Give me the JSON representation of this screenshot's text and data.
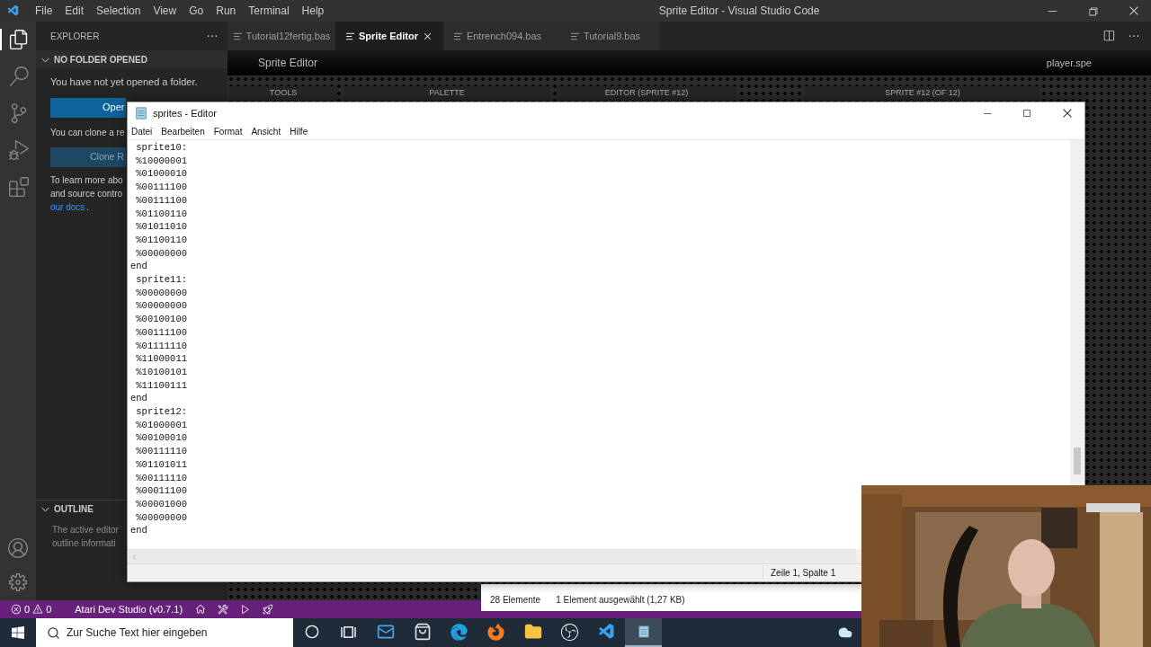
{
  "window": {
    "title": "Sprite Editor - Visual Studio Code"
  },
  "menu_bar": [
    "File",
    "Edit",
    "Selection",
    "View",
    "Go",
    "Run",
    "Terminal",
    "Help"
  ],
  "activity_bar": [
    {
      "kind": "explorer",
      "selected": true
    },
    {
      "kind": "search",
      "selected": false
    },
    {
      "kind": "source-control",
      "selected": false
    },
    {
      "kind": "debug",
      "selected": false
    },
    {
      "kind": "extensions",
      "selected": false
    }
  ],
  "sidebar": {
    "title": "EXPLORER",
    "folder_section": {
      "title": "NO FOLDER OPENED",
      "expanded": true,
      "message": "You have not yet opened a folder.",
      "open_button": "Oper",
      "clone_message": "You can clone a re",
      "clone_button": "Clone R",
      "learn_lines": [
        "To learn more abo",
        "and source contro"
      ],
      "docs_link": "our docs",
      "docs_after": "."
    },
    "outline": {
      "title": "OUTLINE",
      "expanded": true,
      "lines": [
        "The active editor",
        "outline informati"
      ]
    }
  },
  "tabs": [
    {
      "label": "Tutorial12fertig.bas",
      "selected": false
    },
    {
      "label": "Sprite Editor",
      "selected": true
    },
    {
      "label": "Entrench094.bas",
      "selected": false
    },
    {
      "label": "Tutorial9.bas",
      "selected": false
    }
  ],
  "sprite_editor": {
    "title": "Sprite Editor",
    "file": "player.spe",
    "panels": [
      "TOOLS",
      "PALETTE",
      "EDITOR (SPRITE #12)",
      "SPRITE #12 (OF 12)"
    ]
  },
  "notepad": {
    "title": "sprites - Editor",
    "menu": [
      "Datei",
      "Bearbeiten",
      "Format",
      "Ansicht",
      "Hilfe"
    ],
    "lines": [
      " sprite10:",
      " %10000001",
      " %01000010",
      " %00111100",
      " %00111100",
      " %01100110",
      " %01011010",
      " %01100110",
      " %00000000",
      "end",
      " sprite11:",
      " %00000000",
      " %00000000",
      " %00100100",
      " %00111100",
      " %01111110",
      " %11000011",
      " %10100101",
      " %11100111",
      "end",
      " sprite12:",
      " %01000001",
      " %00100010",
      " %00111110",
      " %01101011",
      " %00111110",
      " %00011100",
      " %00001000",
      " %00000000",
      "end"
    ],
    "status": "Zeile 1, Spalte 1"
  },
  "file_explorer": {
    "item_count": "28 Elemente",
    "selection": "1 Element ausgewählt (1,27 KB)"
  },
  "status_bar": {
    "errors": "0",
    "warnings": "0",
    "extension": "Atari Dev Studio (v0.7.1)"
  },
  "taskbar": {
    "search": {
      "placeholder": "Zur Suche Text hier eingeben"
    },
    "apps": [
      {
        "kind": "cortana",
        "selected": false
      },
      {
        "kind": "task-view",
        "selected": false
      },
      {
        "kind": "mail",
        "selected": false
      },
      {
        "kind": "store",
        "selected": false
      },
      {
        "kind": "edge",
        "selected": false
      },
      {
        "kind": "firefox",
        "selected": false
      },
      {
        "kind": "folder",
        "selected": false
      },
      {
        "kind": "obs",
        "selected": false
      },
      {
        "kind": "vscode",
        "selected": false
      },
      {
        "kind": "notepad",
        "selected": true
      }
    ]
  }
}
